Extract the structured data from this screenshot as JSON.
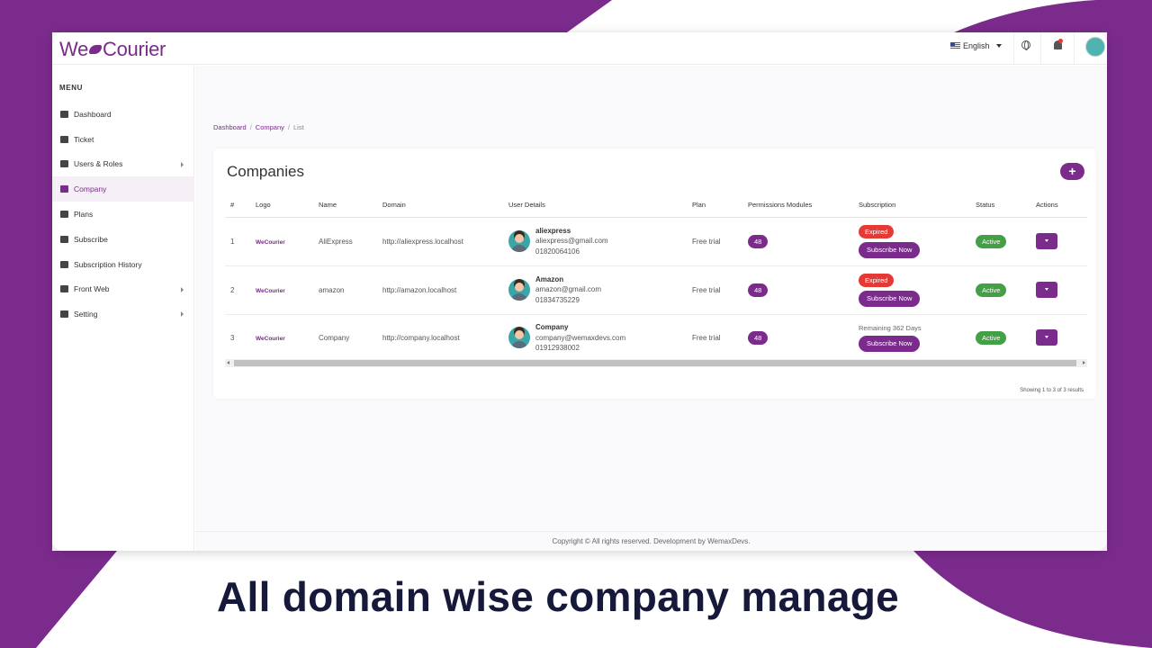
{
  "caption": "All domain wise company manage",
  "colors": {
    "brand": "#7b2b8c",
    "expired": "#e53935",
    "active": "#43a047",
    "background": "#7b2b8c"
  },
  "app": {
    "logo_left": "We",
    "logo_right": "Courier",
    "language": "English"
  },
  "sidebar": {
    "title": "MENU",
    "items": [
      {
        "label": "Dashboard",
        "icon": "home-icon",
        "arrow": false,
        "active": false
      },
      {
        "label": "Ticket",
        "icon": "chat-icon",
        "arrow": false,
        "active": false
      },
      {
        "label": "Users & Roles",
        "icon": "grid-icon",
        "arrow": true,
        "active": false
      },
      {
        "label": "Company",
        "icon": "building-icon",
        "arrow": false,
        "active": true
      },
      {
        "label": "Plans",
        "icon": "list-icon",
        "arrow": false,
        "active": false
      },
      {
        "label": "Subscribe",
        "icon": "users-icon",
        "arrow": false,
        "active": false
      },
      {
        "label": "Subscription History",
        "icon": "history-icon",
        "arrow": false,
        "active": false
      },
      {
        "label": "Front Web",
        "icon": "globe-icon",
        "arrow": true,
        "active": false
      },
      {
        "label": "Setting",
        "icon": "gears-icon",
        "arrow": true,
        "active": false
      }
    ]
  },
  "breadcrumb": {
    "home": "Dashboard",
    "section": "Company",
    "current": "List"
  },
  "card": {
    "title": "Companies",
    "add_label": "+"
  },
  "table": {
    "headers": [
      "#",
      "Logo",
      "Name",
      "Domain",
      "User Details",
      "Plan",
      "Permissions Modules",
      "Subscription",
      "Status",
      "Actions"
    ],
    "rows": [
      {
        "num": "1",
        "logo": "WeCourier",
        "name": "AliExpress",
        "domain": "http://aliexpress.localhost",
        "user_name": "aliexpress",
        "user_email": "aliexpress@gmail.com",
        "user_phone": "01820064106",
        "plan": "Free trial",
        "modules": "48",
        "sub_badge": "Expired",
        "sub_text": "",
        "sub_button": "Subscribe Now",
        "status": "Active"
      },
      {
        "num": "2",
        "logo": "WeCourier",
        "name": "amazon",
        "domain": "http://amazon.localhost",
        "user_name": "Amazon",
        "user_email": "amazon@gmail.com",
        "user_phone": "01834735229",
        "plan": "Free trial",
        "modules": "48",
        "sub_badge": "Expired",
        "sub_text": "",
        "sub_button": "Subscribe Now",
        "status": "Active"
      },
      {
        "num": "3",
        "logo": "WeCourier",
        "name": "Company",
        "domain": "http://company.localhost",
        "user_name": "Company",
        "user_email": "company@wemaxdevs.com",
        "user_phone": "01912938002",
        "plan": "Free trial",
        "modules": "48",
        "sub_badge": "",
        "sub_text": "Remaining 362 Days",
        "sub_button": "Subscribe Now",
        "status": "Active"
      }
    ]
  },
  "showing": "Showing 1 to 3 of 3 results",
  "footer": "Copyright © All rights reserved. Development by WemaxDevs."
}
